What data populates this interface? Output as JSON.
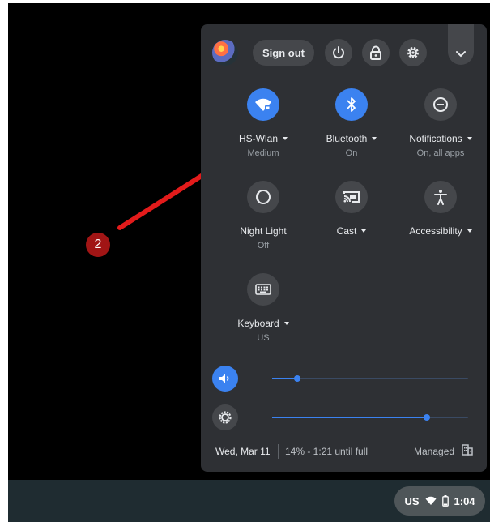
{
  "header": {
    "sign_out_label": "Sign out",
    "icons": [
      "avatar",
      "power-icon",
      "lock-icon",
      "gear-icon",
      "chevron-down-icon"
    ]
  },
  "tiles": [
    {
      "label": "HS-Wlan",
      "sublabel": "Medium",
      "icon": "wifi-icon",
      "active": true,
      "has_menu": true
    },
    {
      "label": "Bluetooth",
      "sublabel": "On",
      "icon": "bluetooth-icon",
      "active": true,
      "has_menu": true
    },
    {
      "label": "Notifications",
      "sublabel": "On, all apps",
      "icon": "do-not-disturb-icon",
      "active": false,
      "has_menu": true
    },
    {
      "label": "Night Light",
      "sublabel": "Off",
      "icon": "night-light-icon",
      "active": false,
      "has_menu": false
    },
    {
      "label": "Cast",
      "sublabel": "",
      "icon": "cast-icon",
      "active": false,
      "has_menu": true
    },
    {
      "label": "Accessibility",
      "sublabel": "",
      "icon": "accessibility-icon",
      "active": false,
      "has_menu": true
    },
    {
      "label": "Keyboard",
      "sublabel": "US",
      "icon": "keyboard-icon",
      "active": false,
      "has_menu": true
    }
  ],
  "sliders": {
    "volume": {
      "icon": "volume-icon",
      "level": 0.13
    },
    "brightness": {
      "icon": "brightness-icon",
      "level": 0.79
    }
  },
  "footer": {
    "date": "Wed, Mar 11",
    "battery": "14% - 1:21 until full",
    "managed": "Managed",
    "managed_icon": "building-icon"
  },
  "tray": {
    "ime": "US",
    "time": "1:04",
    "icons": [
      "wifi-icon",
      "battery-icon"
    ]
  },
  "annotation": {
    "step_number": "2"
  },
  "colors": {
    "panel_bg": "#2e3034",
    "button_bg": "#45474b",
    "accent": "#3b82f0",
    "shelf_bg": "#1f2c31",
    "annotation_red": "#e31b1b",
    "badge_red": "#a11515"
  }
}
